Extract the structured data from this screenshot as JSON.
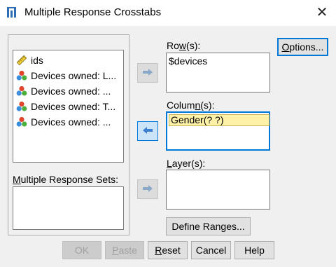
{
  "window": {
    "title": "Multiple Response Crosstabs",
    "close_glyph": "✕"
  },
  "variables": [
    {
      "label": "ids",
      "icon": "scale-ruler-icon"
    },
    {
      "label": "Devices owned: L...",
      "icon": "nominal-variable-icon"
    },
    {
      "label": "Devices owned: ...",
      "icon": "nominal-variable-icon"
    },
    {
      "label": "Devices owned: T...",
      "icon": "nominal-variable-icon"
    },
    {
      "label": "Devices owned: ...",
      "icon": "nominal-variable-icon"
    }
  ],
  "mrs": {
    "label_pre": "",
    "label_mnemonic": "M",
    "label_post": "ultiple Response Sets:"
  },
  "rows": {
    "label_pre": "Ro",
    "label_mnemonic": "w",
    "label_post": "(s):",
    "items": [
      "$devices"
    ]
  },
  "columns": {
    "label_pre": "Colum",
    "label_mnemonic": "n",
    "label_post": "(s):",
    "items": [
      "Gender(? ?)"
    ]
  },
  "layers": {
    "label_pre": "",
    "label_mnemonic": "L",
    "label_post": "ayer(s):"
  },
  "buttons": {
    "options": {
      "pre": "",
      "mn": "O",
      "post": "ptions..."
    },
    "define_ranges": {
      "pre": "Define Ran",
      "mn": "g",
      "post": "es..."
    },
    "ok": "OK",
    "paste": {
      "pre": "",
      "mn": "P",
      "post": "aste"
    },
    "reset": {
      "pre": "",
      "mn": "R",
      "post": "eset"
    },
    "cancel": "Cancel",
    "help": "Help"
  },
  "colors": {
    "accent": "#0078d7",
    "selection_fill": "#fff2a8",
    "arrow_active": "#3d7fd1",
    "arrow_disabled": "#8aa9c9"
  }
}
